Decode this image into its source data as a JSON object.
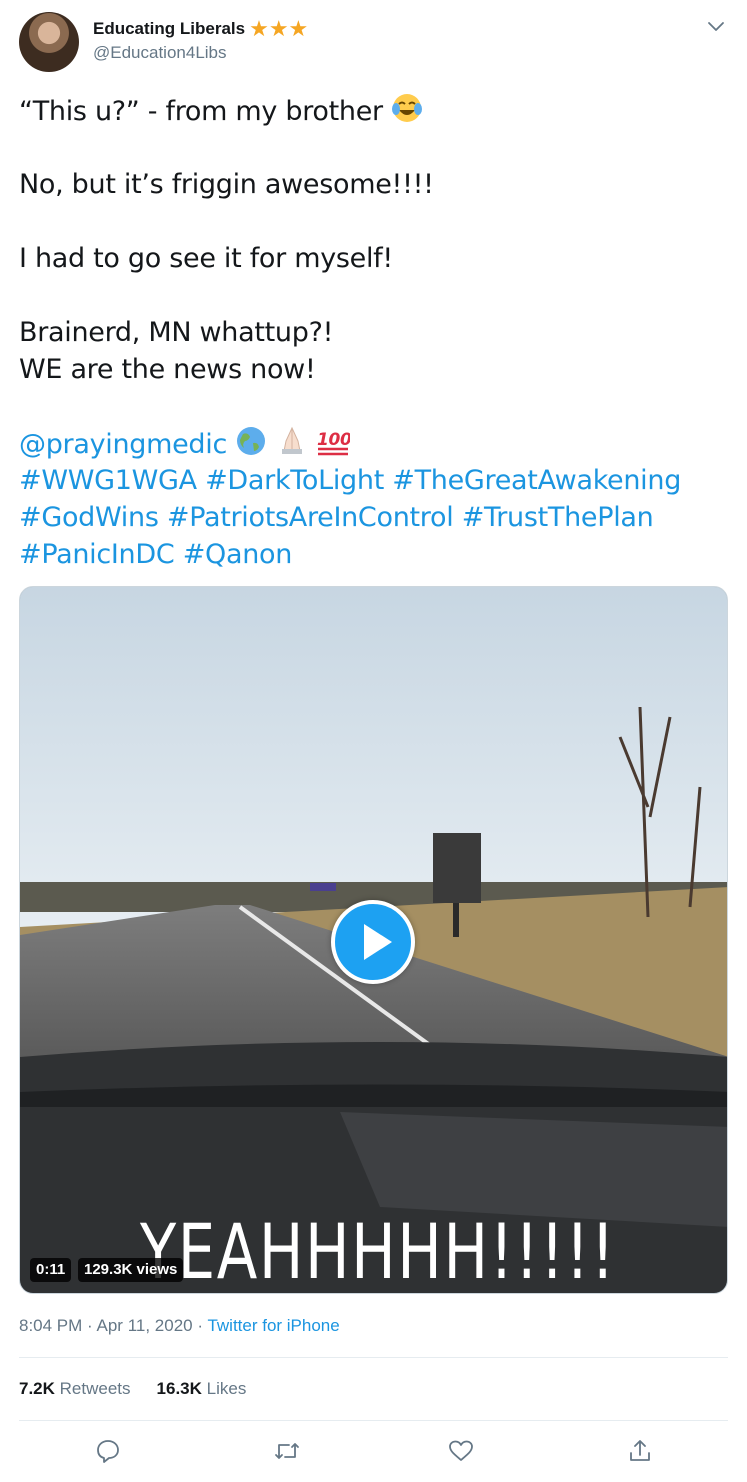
{
  "author": {
    "name": "Educating Liberals",
    "stars": "★★★",
    "handle": "@Education4Libs"
  },
  "tweet": {
    "line1": "“This u?” - from my brother ",
    "line2": "No, but it’s friggin awesome!!!!",
    "line3": "I had to go see it for myself!",
    "line4": "Brainerd, MN whattup?!",
    "line5": "WE are the news now!",
    "mention": "@prayingmedic",
    "hashtags_line1": "#WWG1WGA #DarkToLight #TheGreatAwakening",
    "hashtags_line2": "#GodWins #PatriotsAreInControl #TrustThePlan",
    "hashtags_line3": "#PanicInDC #Qanon",
    "emojis": [
      "face-with-tears-of-joy",
      "globe-americas",
      "folded-hands",
      "hundred-points"
    ]
  },
  "video": {
    "duration": "0:11",
    "views": "129.3K views",
    "overlay_text": "YEAHHHHH!!!!!"
  },
  "meta": {
    "time": "8:04 PM",
    "date": "Apr 11, 2020",
    "separator": "·",
    "source": "Twitter for iPhone"
  },
  "stats": {
    "retweets_count": "7.2K",
    "retweets_label": "Retweets",
    "likes_count": "16.3K",
    "likes_label": "Likes"
  },
  "colors": {
    "link": "#1b95e0",
    "star": "#f5a623",
    "play": "#1da1f2",
    "muted": "#657786"
  }
}
